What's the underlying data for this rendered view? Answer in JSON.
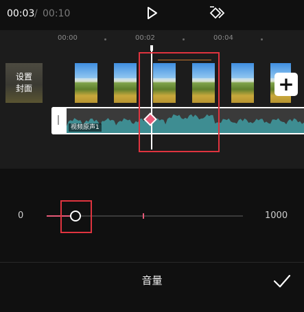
{
  "header": {
    "current_time": "00:03",
    "separator": "/",
    "total_time": "00:10",
    "play_icon": "play-icon",
    "keyframe_icon": "keyframe-add-icon"
  },
  "timeline": {
    "ticks": [
      "00:00",
      "00:02",
      "00:04"
    ],
    "cover_button_label": "设置\n封面",
    "add_clip_icon": "+",
    "audio_track_label": "视频原声1",
    "keyframe_icon": "keyframe-diamond-icon"
  },
  "volume_slider": {
    "min_label": "0",
    "max_label": "1000",
    "current_fraction": 0.15,
    "marker_fraction": 0.49,
    "accent_color": "#e85a78"
  },
  "bottom_bar": {
    "title": "音量",
    "confirm_icon": "check-icon"
  },
  "colors": {
    "highlight": "#e0343f",
    "waveform": "#3e8d92",
    "background": "#101010"
  }
}
